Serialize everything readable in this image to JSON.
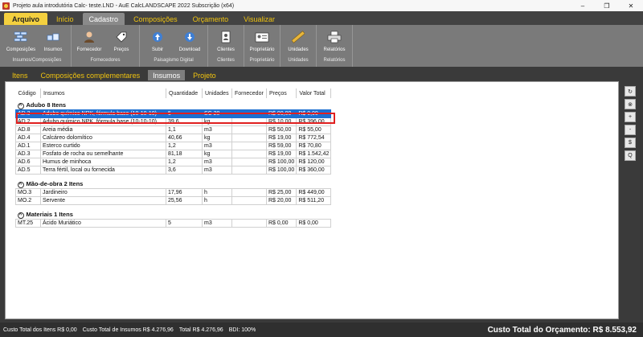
{
  "window": {
    "title": "Projeto aula introdutória Calc- teste.LND - AuE CalcLANDSCAPE 2022 Subscrição (x64)",
    "minimize": "–",
    "restore": "❐",
    "close": "✕"
  },
  "menu": [
    "Arquivo",
    "Início",
    "Cadastro",
    "Composições",
    "Orçamento",
    "Visualizar"
  ],
  "ribbon": {
    "groups": [
      {
        "label": "Insumos/Composições",
        "buttons": [
          {
            "label": "Composições",
            "icon": "bricks-icon"
          },
          {
            "label": "Insumos",
            "icon": "boxes-icon"
          }
        ]
      },
      {
        "label": "Fornecedores",
        "buttons": [
          {
            "label": "Fornecedor",
            "icon": "person-icon"
          },
          {
            "label": "Preços",
            "icon": "price-tag-icon"
          }
        ]
      },
      {
        "label": "Paisagismo Digital",
        "buttons": [
          {
            "label": "Subir",
            "icon": "upload-icon"
          },
          {
            "label": "Download",
            "icon": "download-icon"
          }
        ]
      },
      {
        "label": "Clientes",
        "buttons": [
          {
            "label": "Clientes",
            "icon": "clients-icon"
          }
        ]
      },
      {
        "label": "Proprietário",
        "buttons": [
          {
            "label": "Proprietário",
            "icon": "id-card-icon"
          }
        ]
      },
      {
        "label": "Unidades",
        "buttons": [
          {
            "label": "Unidades",
            "icon": "ruler-icon"
          }
        ]
      },
      {
        "label": "Relatórios",
        "buttons": [
          {
            "label": "Relatórios",
            "icon": "printer-icon"
          }
        ]
      }
    ]
  },
  "tabs": [
    "Itens",
    "Composições complementares",
    "Insumos",
    "Projeto"
  ],
  "table": {
    "headers": [
      "Código",
      "Insumos",
      "Quantidade",
      "Unidades",
      "Fornecedor",
      "Preços",
      "Valor Total"
    ],
    "groups": [
      {
        "title": "Adubo  8 Itens",
        "rows": [
          [
            "AD.3",
            "Adubo químico NPK, fórmula base (10-10-10)",
            "5",
            "SC 20",
            "",
            "R$ 00,00",
            "R$ 0,00"
          ],
          [
            "AD.2",
            "Adubo químico NPK, fórmula base (10-10-10)",
            "39,6",
            "kg",
            "",
            "R$ 10,00",
            "R$ 396,00"
          ],
          [
            "AD.8",
            "Areia média",
            "1,1",
            "m3",
            "",
            "R$ 50,00",
            "R$ 55,00"
          ],
          [
            "AD.4",
            "Calcáreo dolomítico",
            "40,66",
            "kg",
            "",
            "R$ 19,00",
            "R$ 772,54"
          ],
          [
            "AD.1",
            "Esterco curtido",
            "1,2",
            "m3",
            "",
            "R$ 59,00",
            "R$ 70,80"
          ],
          [
            "AD.3",
            "Fosfato de rocha ou semelhante",
            "81,18",
            "kg",
            "",
            "R$ 19,00",
            "R$ 1.542,42"
          ],
          [
            "AD.6",
            "Humus de minhoca",
            "1,2",
            "m3",
            "",
            "R$ 100,00",
            "R$ 120,00"
          ],
          [
            "AD.5",
            "Terra fértil, local ou fornecida",
            "3,6",
            "m3",
            "",
            "R$ 100,00",
            "R$ 360,00"
          ]
        ]
      },
      {
        "title": "Mão-de-obra  2 Itens",
        "rows": [
          [
            "MO.3",
            "Jardineiro",
            "17,96",
            "h",
            "",
            "R$ 25,00",
            "R$ 449,00"
          ],
          [
            "MO.2",
            "Servente",
            "25,56",
            "h",
            "",
            "R$ 20,00",
            "R$ 511,20"
          ]
        ]
      },
      {
        "title": "Materiais  1 Itens",
        "rows": [
          [
            "MT.25",
            "Ácido Muriático",
            "5",
            "m3",
            "",
            "R$ 0,00",
            "R$ 0,00"
          ]
        ]
      }
    ],
    "collapse_symbol": "^"
  },
  "sidebar": [
    "↻",
    "⊗",
    "+",
    "-",
    "$",
    "Q"
  ],
  "status": {
    "itens": "Custo Total dos Itens R$ 0,00",
    "insumos": "Custo Total de Insumos R$ 4.276,96",
    "total": "Total R$ 4.276,96",
    "bdi": "BDI: 100%",
    "orcamento": "Custo Total do Orçamento: R$ 8.553,92"
  }
}
